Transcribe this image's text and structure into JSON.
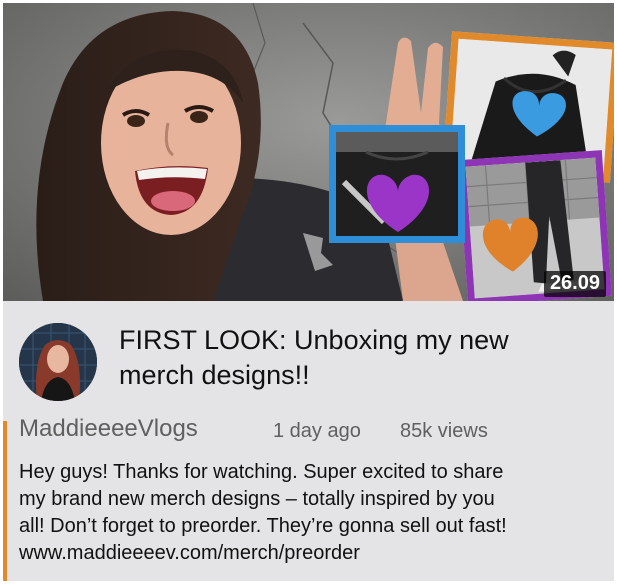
{
  "video": {
    "duration": "26.09",
    "title_line1": "FIRST LOOK: Unboxing my new",
    "title_line2": "merch designs!!",
    "channel": "MaddieeeeVlogs",
    "age": "1 day ago",
    "views": "85k views",
    "description_lines": [
      "Hey guys! Thanks for watching. Super excited to share",
      "my brand new merch designs – totally inspired by you",
      "all! Don’t forget to preorder. They’re gonna sell out fast!"
    ],
    "link": "www.maddieeeev.com/merch/preorder"
  },
  "colors": {
    "card_bg": "#e4e4e6",
    "orange_frame": "#e08a2c",
    "blue_frame": "#2f8ed8",
    "purple_frame": "#8e35b5",
    "heart_purple": "#9b35c8",
    "heart_blue": "#3a9be0",
    "heart_orange": "#e0822c"
  },
  "icons": [
    "heart-icon",
    "peace-sign-hand"
  ]
}
